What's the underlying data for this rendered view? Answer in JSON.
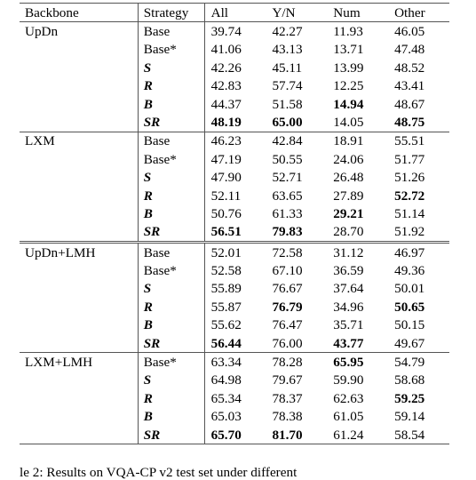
{
  "table": {
    "columns": [
      "Backbone",
      "Strategy",
      "All",
      "Y/N",
      "Num",
      "Other"
    ],
    "blocks": [
      {
        "backbone": "UpDn",
        "divider_above": "top",
        "rows": [
          {
            "strategy": "Base",
            "strategy_style": "plain",
            "values": [
              "39.74",
              "42.27",
              "11.93",
              "46.05"
            ],
            "bold": [
              false,
              false,
              false,
              false
            ]
          },
          {
            "strategy": "Base*",
            "strategy_style": "plain",
            "values": [
              "41.06",
              "43.13",
              "13.71",
              "47.48"
            ],
            "bold": [
              false,
              false,
              false,
              false
            ]
          },
          {
            "strategy": "S",
            "strategy_style": "em",
            "values": [
              "42.26",
              "45.11",
              "13.99",
              "48.52"
            ],
            "bold": [
              false,
              false,
              false,
              false
            ]
          },
          {
            "strategy": "R",
            "strategy_style": "em",
            "values": [
              "42.83",
              "57.74",
              "12.25",
              "43.41"
            ],
            "bold": [
              false,
              false,
              false,
              false
            ]
          },
          {
            "strategy": "B",
            "strategy_style": "em",
            "values": [
              "44.37",
              "51.58",
              "14.94",
              "48.67"
            ],
            "bold": [
              false,
              false,
              true,
              false
            ]
          },
          {
            "strategy": "SR",
            "strategy_style": "em",
            "values": [
              "48.19",
              "65.00",
              "14.05",
              "48.75"
            ],
            "bold": [
              true,
              true,
              false,
              true
            ]
          }
        ]
      },
      {
        "backbone": "LXM",
        "divider_above": "single",
        "rows": [
          {
            "strategy": "Base",
            "strategy_style": "plain",
            "values": [
              "46.23",
              "42.84",
              "18.91",
              "55.51"
            ],
            "bold": [
              false,
              false,
              false,
              false
            ]
          },
          {
            "strategy": "Base*",
            "strategy_style": "plain",
            "values": [
              "47.19",
              "50.55",
              "24.06",
              "51.77"
            ],
            "bold": [
              false,
              false,
              false,
              false
            ]
          },
          {
            "strategy": "S",
            "strategy_style": "em",
            "values": [
              "47.90",
              "52.71",
              "26.48",
              "51.26"
            ],
            "bold": [
              false,
              false,
              false,
              false
            ]
          },
          {
            "strategy": "R",
            "strategy_style": "em",
            "values": [
              "52.11",
              "63.65",
              "27.89",
              "52.72"
            ],
            "bold": [
              false,
              false,
              false,
              true
            ]
          },
          {
            "strategy": "B",
            "strategy_style": "em",
            "values": [
              "50.76",
              "61.33",
              "29.21",
              "51.14"
            ],
            "bold": [
              false,
              false,
              true,
              false
            ]
          },
          {
            "strategy": "SR",
            "strategy_style": "em",
            "values": [
              "56.51",
              "79.83",
              "28.70",
              "51.92"
            ],
            "bold": [
              true,
              true,
              false,
              false
            ]
          }
        ]
      },
      {
        "backbone": "UpDn+LMH",
        "divider_above": "double",
        "rows": [
          {
            "strategy": "Base",
            "strategy_style": "plain",
            "values": [
              "52.01",
              "72.58",
              "31.12",
              "46.97"
            ],
            "bold": [
              false,
              false,
              false,
              false
            ]
          },
          {
            "strategy": "Base*",
            "strategy_style": "plain",
            "values": [
              "52.58",
              "67.10",
              "36.59",
              "49.36"
            ],
            "bold": [
              false,
              false,
              false,
              false
            ]
          },
          {
            "strategy": "S",
            "strategy_style": "em",
            "values": [
              "55.89",
              "76.67",
              "37.64",
              "50.01"
            ],
            "bold": [
              false,
              false,
              false,
              false
            ]
          },
          {
            "strategy": "R",
            "strategy_style": "em",
            "values": [
              "55.87",
              "76.79",
              "34.96",
              "50.65"
            ],
            "bold": [
              false,
              true,
              false,
              true
            ]
          },
          {
            "strategy": "B",
            "strategy_style": "em",
            "values": [
              "55.62",
              "76.47",
              "35.71",
              "50.15"
            ],
            "bold": [
              false,
              false,
              false,
              false
            ]
          },
          {
            "strategy": "SR",
            "strategy_style": "em",
            "values": [
              "56.44",
              "76.00",
              "43.77",
              "49.67"
            ],
            "bold": [
              true,
              false,
              true,
              false
            ]
          }
        ]
      },
      {
        "backbone": "LXM+LMH",
        "divider_above": "single",
        "rows": [
          {
            "strategy": "Base*",
            "strategy_style": "plain",
            "values": [
              "63.34",
              "78.28",
              "65.95",
              "54.79"
            ],
            "bold": [
              false,
              false,
              true,
              false
            ]
          },
          {
            "strategy": "S",
            "strategy_style": "em",
            "values": [
              "64.98",
              "79.67",
              "59.90",
              "58.68"
            ],
            "bold": [
              false,
              false,
              false,
              false
            ]
          },
          {
            "strategy": "R",
            "strategy_style": "em",
            "values": [
              "65.34",
              "78.37",
              "62.63",
              "59.25"
            ],
            "bold": [
              false,
              false,
              false,
              true
            ]
          },
          {
            "strategy": "B",
            "strategy_style": "em",
            "values": [
              "65.03",
              "78.38",
              "61.05",
              "59.14"
            ],
            "bold": [
              false,
              false,
              false,
              false
            ]
          },
          {
            "strategy": "SR",
            "strategy_style": "em",
            "values": [
              "65.70",
              "81.70",
              "61.24",
              "58.54"
            ],
            "bold": [
              true,
              true,
              false,
              false
            ]
          }
        ]
      }
    ]
  },
  "caption": {
    "text": "le 2: Results on VQA-CP v2 test set under different"
  },
  "colors": {
    "rule": "#555555",
    "text": "#000000",
    "background": "#ffffff"
  }
}
